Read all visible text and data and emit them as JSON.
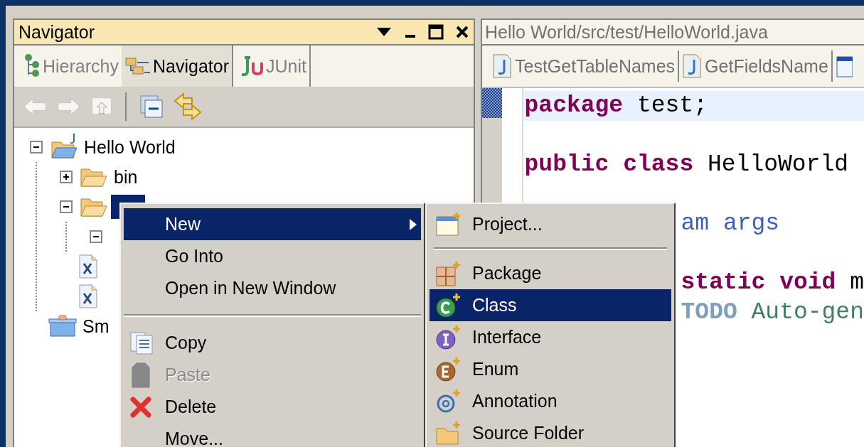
{
  "navigator": {
    "title": "Navigator",
    "tabs": [
      {
        "label": "Hierarchy",
        "kind": "hierarchy",
        "selected": false
      },
      {
        "label": "Navigator",
        "kind": "navigator",
        "selected": true
      },
      {
        "label": "JUnit",
        "kind": "junit",
        "selected": false
      }
    ],
    "toolbar": [
      {
        "kind": "back",
        "disabled": true
      },
      {
        "kind": "forward",
        "disabled": true
      },
      {
        "kind": "up",
        "disabled": true
      },
      {
        "kind": "collapse",
        "disabled": false
      },
      {
        "kind": "link",
        "disabled": false
      }
    ],
    "tree": [
      {
        "label": "Hello World",
        "kind": "project",
        "expanded": true,
        "selected": false,
        "children": [
          {
            "label": "bin",
            "kind": "folder",
            "expanded": false,
            "selected": false
          },
          {
            "kind": "folder",
            "expanded": true,
            "selected": true,
            "children": [
              {
                "expanded": true,
                "selected": false
              }
            ]
          },
          {
            "kind": "xml",
            "selected": false
          },
          {
            "kind": "xml",
            "selected": false
          }
        ]
      },
      {
        "label": "Sm",
        "kind": "server",
        "selected": false
      }
    ]
  },
  "editor": {
    "title": "Hello World/src/test/HelloWorld.java",
    "tabs": [
      {
        "label": "TestGetTableNames",
        "kind": "java"
      },
      {
        "label": "GetFieldsName",
        "kind": "java"
      },
      {
        "kind": "form"
      }
    ],
    "lines": [
      {
        "kind": "full",
        "current": true,
        "tokens": [
          {
            "text": "package",
            "kind": "keyword"
          },
          {
            "text": " test;",
            "kind": "plain"
          }
        ]
      },
      {
        "kind": "blank",
        "current": false
      },
      {
        "kind": "full",
        "current": false,
        "tokens": [
          {
            "text": "public",
            "kind": "keyword"
          },
          {
            "text": " class",
            "kind": "keyword"
          },
          {
            "text": " HelloWorld",
            "kind": "plain"
          }
        ]
      },
      {
        "kind": "blank",
        "current": false
      },
      {
        "kind": "covered",
        "current": false,
        "tokens": [
          {
            "text": "am args",
            "kind": "doc"
          }
        ]
      },
      {
        "kind": "blank",
        "current": false
      },
      {
        "kind": "covered",
        "current": false,
        "tokens": [
          {
            "text": "static",
            "kind": "keyword"
          },
          {
            "text": " void",
            "kind": "keyword"
          },
          {
            "text": " m",
            "kind": "plain"
          }
        ]
      },
      {
        "kind": "covered",
        "current": false,
        "tokens": [
          {
            "text": "TODO",
            "kind": "tag"
          },
          {
            "text": " Auto-gen",
            "kind": "comment"
          }
        ]
      }
    ]
  },
  "context_menu": [
    {
      "label": "New",
      "kind": "submenu",
      "selected": true,
      "disabled": false
    },
    {
      "label": "Go Into",
      "kind": "plain",
      "selected": false,
      "disabled": false
    },
    {
      "label": "Open in New Window",
      "kind": "plain",
      "selected": false,
      "disabled": false
    },
    {
      "kind": "separator"
    },
    {
      "label": "Copy",
      "kind": "copy",
      "selected": false,
      "disabled": false
    },
    {
      "label": "Paste",
      "kind": "paste",
      "selected": false,
      "disabled": true
    },
    {
      "label": "Delete",
      "kind": "delete",
      "selected": false,
      "disabled": false
    },
    {
      "label": "Move...",
      "kind": "plain",
      "selected": false,
      "disabled": false
    }
  ],
  "new_submenu": [
    {
      "label": "Project...",
      "kind": "project",
      "selected": false,
      "disabled": false
    },
    {
      "kind": "separator"
    },
    {
      "label": "Package",
      "kind": "package",
      "selected": false,
      "disabled": false
    },
    {
      "label": "Class",
      "kind": "class",
      "selected": true,
      "disabled": false
    },
    {
      "label": "Interface",
      "kind": "interface",
      "selected": false,
      "disabled": false
    },
    {
      "label": "Enum",
      "kind": "enum",
      "selected": false,
      "disabled": false
    },
    {
      "label": "Annotation",
      "kind": "annotation",
      "selected": false,
      "disabled": false
    },
    {
      "label": "Source Folder",
      "kind": "source-folder",
      "selected": false,
      "disabled": false
    }
  ]
}
